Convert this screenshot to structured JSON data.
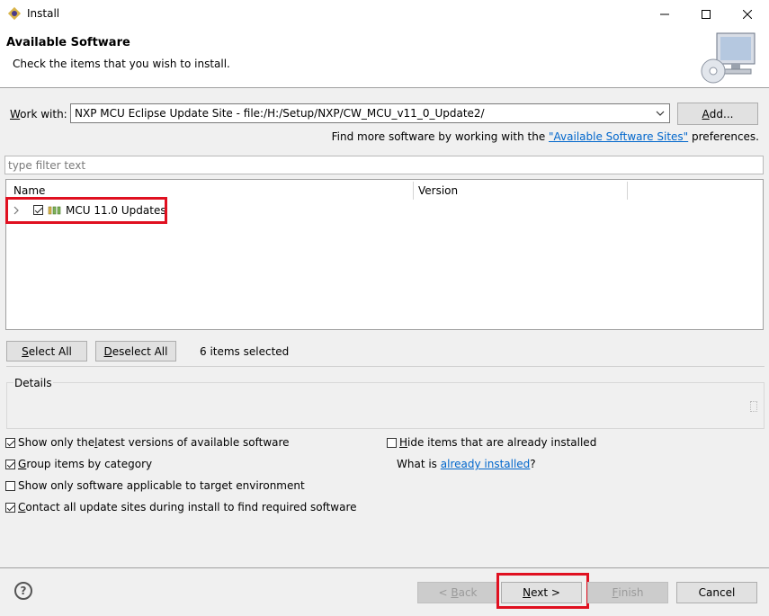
{
  "window": {
    "title": "Install",
    "icon": "eclipse-install-icon"
  },
  "header": {
    "title": "Available Software",
    "subtitle": "Check the items that you wish to install."
  },
  "work_with": {
    "label_prefix": "W",
    "label_rest": "ork with:",
    "value": "NXP MCU Eclipse Update Site - file:/H:/Setup/NXP/CW_MCU_v11_0_Update2/",
    "add_label_prefix": "A",
    "add_label_rest": "dd..."
  },
  "find_more": {
    "before": "Find more software by working with the ",
    "link": "\"Available Software Sites\"",
    "after": " preferences."
  },
  "filter": {
    "placeholder": "type filter text"
  },
  "tree": {
    "columns": [
      "Name",
      "Version"
    ],
    "rows": [
      {
        "label": "MCU 11.0 Updates",
        "checked": true,
        "expanded": false
      }
    ]
  },
  "selection": {
    "select_all_prefix": "S",
    "select_all_rest": "elect All",
    "deselect_all_prefix": "D",
    "deselect_all_rest": "eselect All",
    "status": "6 items selected"
  },
  "details": {
    "label": "Details"
  },
  "options": {
    "latest": {
      "before": "Show only the ",
      "key": "l",
      "after": "atest versions of available software",
      "checked": true
    },
    "group": {
      "before": "",
      "key": "G",
      "after": "roup items by category",
      "checked": true
    },
    "applicable": {
      "before": "Show only software applicable to target environment",
      "key": "",
      "after": "",
      "checked": false
    },
    "contact": {
      "before": "",
      "key": "C",
      "after": "ontact all update sites during install to find required software",
      "checked": true
    },
    "hide": {
      "before": "",
      "key": "H",
      "after": "ide items that are already installed",
      "checked": false
    },
    "what_is_before": "What is ",
    "what_is_link": "already installed",
    "what_is_after": "?"
  },
  "footer": {
    "back_prefix": "< ",
    "back_key": "B",
    "back_rest": "ack",
    "next_key": "N",
    "next_rest": "ext >",
    "finish_key": "F",
    "finish_rest": "inish",
    "cancel": "Cancel"
  },
  "colors": {
    "highlight": "#e01020",
    "link": "#0066cc"
  }
}
